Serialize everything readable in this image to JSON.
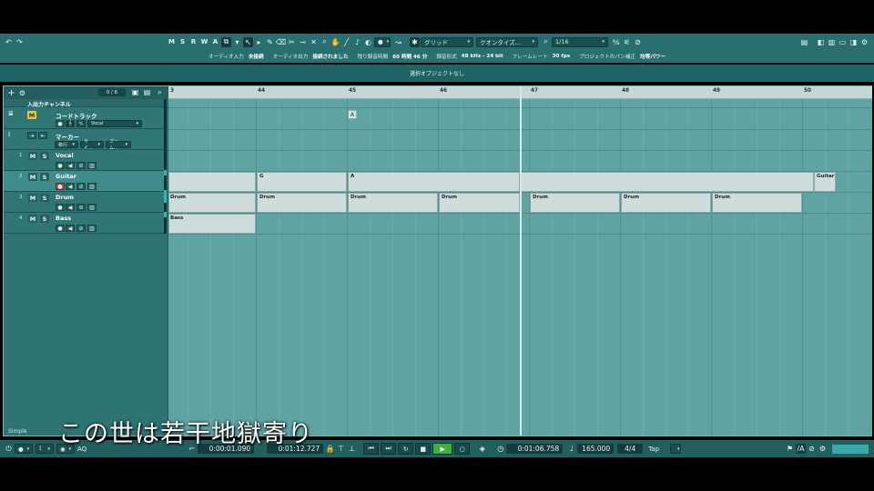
{
  "toolbar": {
    "undo": "↶",
    "redo": "↷",
    "msrwa": [
      "M",
      "S",
      "R",
      "W",
      "A"
    ],
    "grid_label": "グリッド",
    "quantize_label": "クオンタイズ...",
    "quantize_value": "1/16"
  },
  "infoline": [
    {
      "label": "オーディオ入力",
      "value": "未接続"
    },
    {
      "label": "オーディオ出力",
      "value": "接続されました"
    },
    {
      "label": "残り録音時間",
      "value": "60 時間 46 分"
    },
    {
      "label": "録音形式",
      "value": "48 kHz - 24 bit"
    },
    {
      "label": "フレームレート",
      "value": "30 fps"
    },
    {
      "label": "プロジェクトのパン補正",
      "value": "均等パワー"
    }
  ],
  "selection_status": "選択オブジェクトなし",
  "tracklist": {
    "header_count": "0 / 6",
    "io_channel": "入出力チャンネル",
    "chord_track": {
      "label": "コードトラック",
      "m": "M",
      "instrument": "Vocal"
    },
    "marker_track": {
      "label": "マーカー",
      "fields": [
        "移行",
        "サイ...",
        "ズーム..."
      ]
    },
    "tracks": [
      {
        "num": "1",
        "name": "Vocal",
        "m": "M",
        "s": "S"
      },
      {
        "num": "2",
        "name": "Guitar",
        "m": "M",
        "s": "S"
      },
      {
        "num": "3",
        "name": "Drum",
        "m": "M",
        "s": "S"
      },
      {
        "num": "4",
        "name": "Bass",
        "m": "M",
        "s": "S"
      }
    ]
  },
  "ruler": {
    "bars": [
      "3",
      "44",
      "45",
      "46",
      "47",
      "48",
      "49",
      "50"
    ]
  },
  "arrange": {
    "chord_A": "A",
    "guitar_parts": [
      "G",
      "A",
      "Guitar"
    ],
    "drum_parts": [
      "Drum",
      "Drum",
      "Drum",
      "Drum",
      "Drum",
      "Drum",
      "Drum"
    ],
    "bass_part": "Bass"
  },
  "status_text": "Simple",
  "transport": {
    "aq": "AQ",
    "left_locator": "0:00:01.090",
    "right_locator": "0:01:12.727",
    "position": "0:01:06.758",
    "tempo": "165.000",
    "signature": "4/4",
    "tap": "Tap"
  },
  "subtitle": "この世は若干地獄寄り",
  "colors": {
    "accent": "#2a6f6f",
    "record": "#d9372f",
    "play": "#3fb23c"
  }
}
